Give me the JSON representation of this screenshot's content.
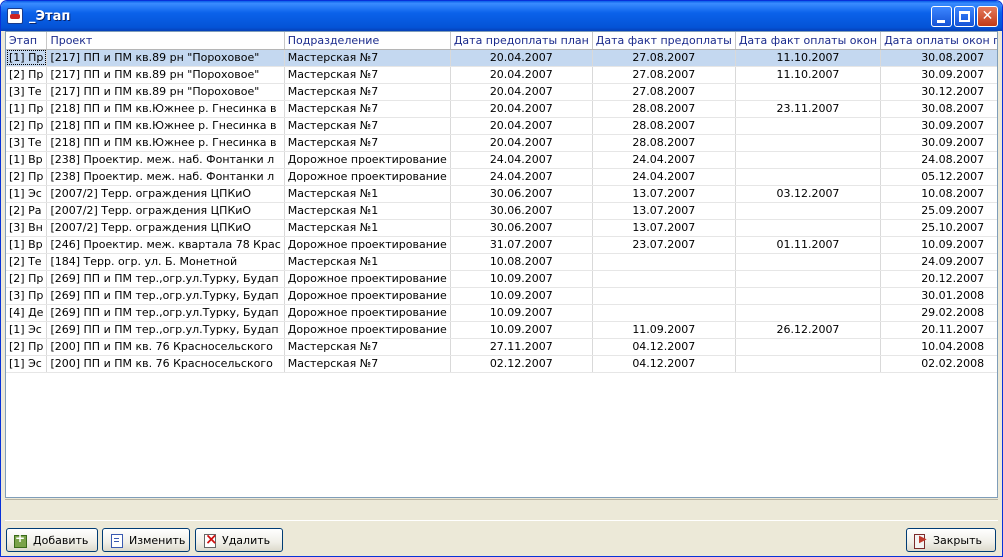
{
  "window": {
    "title": "_Этап"
  },
  "grid": {
    "columns": [
      "Этап",
      "Проект",
      "Подразделение",
      "Дата предоплаты план",
      "Дата факт предоплаты",
      "Дата факт оплаты окон",
      "Дата оплаты окон план"
    ],
    "rows": [
      [
        "[1] Пр",
        "[217] ПП и ПМ кв.89 рн \"Пороховое\"",
        "Мастерская №7",
        "20.04.2007",
        "27.08.2007",
        "11.10.2007",
        "30.08.2007"
      ],
      [
        "[2] Пр",
        "[217] ПП и ПМ кв.89 рн \"Пороховое\"",
        "Мастерская №7",
        "20.04.2007",
        "27.08.2007",
        "11.10.2007",
        "30.09.2007"
      ],
      [
        "[3] Те",
        "[217] ПП и ПМ кв.89 рн \"Пороховое\"",
        "Мастерская №7",
        "20.04.2007",
        "27.08.2007",
        "",
        "30.12.2007"
      ],
      [
        "[1] Пр",
        "[218] ПП и ПМ кв.Южнее р. Гнесинка в",
        "Мастерская №7",
        "20.04.2007",
        "28.08.2007",
        "23.11.2007",
        "30.08.2007"
      ],
      [
        "[2] Пр",
        "[218] ПП и ПМ кв.Южнее р. Гнесинка в",
        "Мастерская №7",
        "20.04.2007",
        "28.08.2007",
        "",
        "30.09.2007"
      ],
      [
        "[3] Те",
        "[218] ПП и ПМ кв.Южнее р. Гнесинка в",
        "Мастерская №7",
        "20.04.2007",
        "28.08.2007",
        "",
        "30.09.2007"
      ],
      [
        "[1] Вр",
        "[238] Проектир. меж. наб. Фонтанки л",
        "Дорожное проектирование",
        "24.04.2007",
        "24.04.2007",
        "",
        "24.08.2007"
      ],
      [
        "[2] Пр",
        "[238] Проектир. меж. наб. Фонтанки л",
        "Дорожное проектирование",
        "24.04.2007",
        "24.04.2007",
        "",
        "05.12.2007"
      ],
      [
        "[1] Эс",
        "[2007/2] Терр. ограждения ЦПКиО",
        "Мастерская №1",
        "30.06.2007",
        "13.07.2007",
        "03.12.2007",
        "10.08.2007"
      ],
      [
        "[2] Ра",
        "[2007/2] Терр. ограждения ЦПКиО",
        "Мастерская №1",
        "30.06.2007",
        "13.07.2007",
        "",
        "25.09.2007"
      ],
      [
        "[3] Вн",
        "[2007/2] Терр. ограждения ЦПКиО",
        "Мастерская №1",
        "30.06.2007",
        "13.07.2007",
        "",
        "25.10.2007"
      ],
      [
        "[1] Вр",
        "[246] Проектир. меж. квартала 78 Крас",
        "Дорожное проектирование",
        "31.07.2007",
        "23.07.2007",
        "01.11.2007",
        "10.09.2007"
      ],
      [
        "[2] Те",
        "[184] Терр. огр. ул. Б. Монетной",
        "Мастерская №1",
        "10.08.2007",
        "",
        "",
        "24.09.2007"
      ],
      [
        "[2] Пр",
        "[269] ПП и ПМ тер.,огр.ул.Турку, Будап",
        "Дорожное проектирование",
        "10.09.2007",
        "",
        "",
        "20.12.2007"
      ],
      [
        "[3] Пр",
        "[269] ПП и ПМ тер.,огр.ул.Турку, Будап",
        "Дорожное проектирование",
        "10.09.2007",
        "",
        "",
        "30.01.2008"
      ],
      [
        "[4] Де",
        "[269] ПП и ПМ тер.,огр.ул.Турку, Будап",
        "Дорожное проектирование",
        "10.09.2007",
        "",
        "",
        "29.02.2008"
      ],
      [
        "[1] Эс",
        "[269] ПП и ПМ тер.,огр.ул.Турку, Будап",
        "Дорожное проектирование",
        "10.09.2007",
        "11.09.2007",
        "26.12.2007",
        "20.11.2007"
      ],
      [
        "[2] Пр",
        "[200] ПП и ПМ кв. 76 Красносельского",
        "Мастерская №7",
        "27.11.2007",
        "04.12.2007",
        "",
        "10.04.2008"
      ],
      [
        "[1] Эс",
        "[200] ПП и ПМ кв. 76 Красносельского",
        "Мастерская №7",
        "02.12.2007",
        "04.12.2007",
        "",
        "02.02.2008"
      ]
    ],
    "selected_row": 0
  },
  "buttons": {
    "add": "Добавить",
    "edit": "Изменить",
    "delete": "Удалить",
    "close": "Закрыть"
  },
  "colors": {
    "titlebar": "#0453D6",
    "header_text": "#1a2a8c",
    "selection": "#C4D8F0",
    "window_bg": "#ECE9D8"
  }
}
